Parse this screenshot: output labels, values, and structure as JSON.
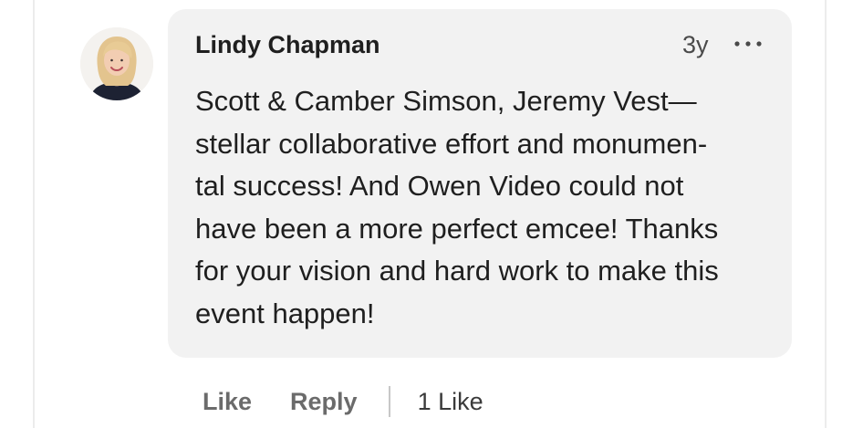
{
  "comment": {
    "author": "Lindy Chapman",
    "age": "3y",
    "more_icon": "more-horizontal-icon",
    "text_lines": [
      "Scott & Camber Simson, Jeremy Vest—",
      "stellar collaborative effort and monumen-",
      "tal success! And Owen Video could not",
      "have been a more perfect emcee! Thanks",
      "for your vision and hard work to make this",
      "event happen!"
    ]
  },
  "actions": {
    "like_label": "Like",
    "reply_label": "Reply",
    "likes_count": "1 Like"
  },
  "colors": {
    "bubble": "#f2f2f2",
    "text": "#1f1f1f",
    "muted": "#6b6b6b"
  }
}
